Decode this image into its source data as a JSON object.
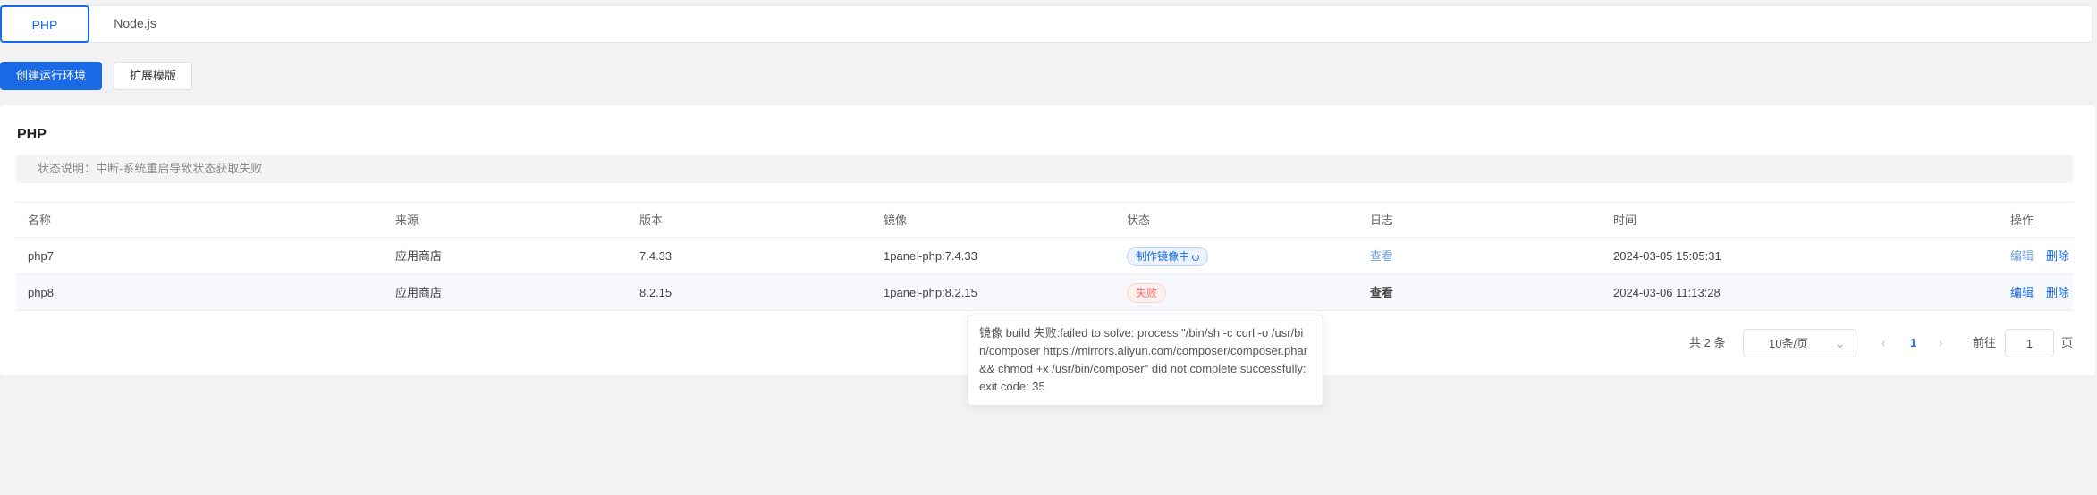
{
  "tabs": [
    {
      "label": "PHP"
    },
    {
      "label": "Node.js"
    }
  ],
  "toolbar": {
    "create_label": "创建运行环境",
    "extend_label": "扩展模版"
  },
  "panel": {
    "title": "PHP",
    "notice": "状态说明：中断-系统重启导致状态获取失败"
  },
  "table": {
    "headers": [
      "名称",
      "来源",
      "版本",
      "镜像",
      "状态",
      "日志",
      "时间",
      "操作"
    ],
    "rows": [
      {
        "name": "php7",
        "source": "应用商店",
        "version": "7.4.33",
        "image": "1panel-php:7.4.33",
        "status": "制作镜像中",
        "log": "查看",
        "time": "2024-03-05 15:05:31",
        "edit": "编辑",
        "delete": "删除"
      },
      {
        "name": "php8",
        "source": "应用商店",
        "version": "8.2.15",
        "image": "1panel-php:8.2.15",
        "status": "失败",
        "log": "查看",
        "time": "2024-03-06 11:13:28",
        "edit": "编辑",
        "delete": "删除"
      }
    ]
  },
  "tooltip": {
    "text": "镜像 build 失败:failed to solve: process \"/bin/sh -c curl -o /usr/bin/composer  https://mirrors.aliyun.com/composer/composer.phar && chmod +x /usr/bin/composer\" did not complete successfully: exit code: 35"
  },
  "pagination": {
    "total": "共 2 条",
    "page_size": "10条/页",
    "current_page": "1",
    "goto_label": "前往",
    "goto_value": "1",
    "page_unit": "页"
  },
  "icons": {
    "loading": "spinner-icon",
    "chevron": "chevron-down-icon",
    "prev": "chevron-left-icon",
    "next": "chevron-right-icon"
  },
  "colors": {
    "primary": "#1a6ae6",
    "danger": "#f56c6c"
  }
}
